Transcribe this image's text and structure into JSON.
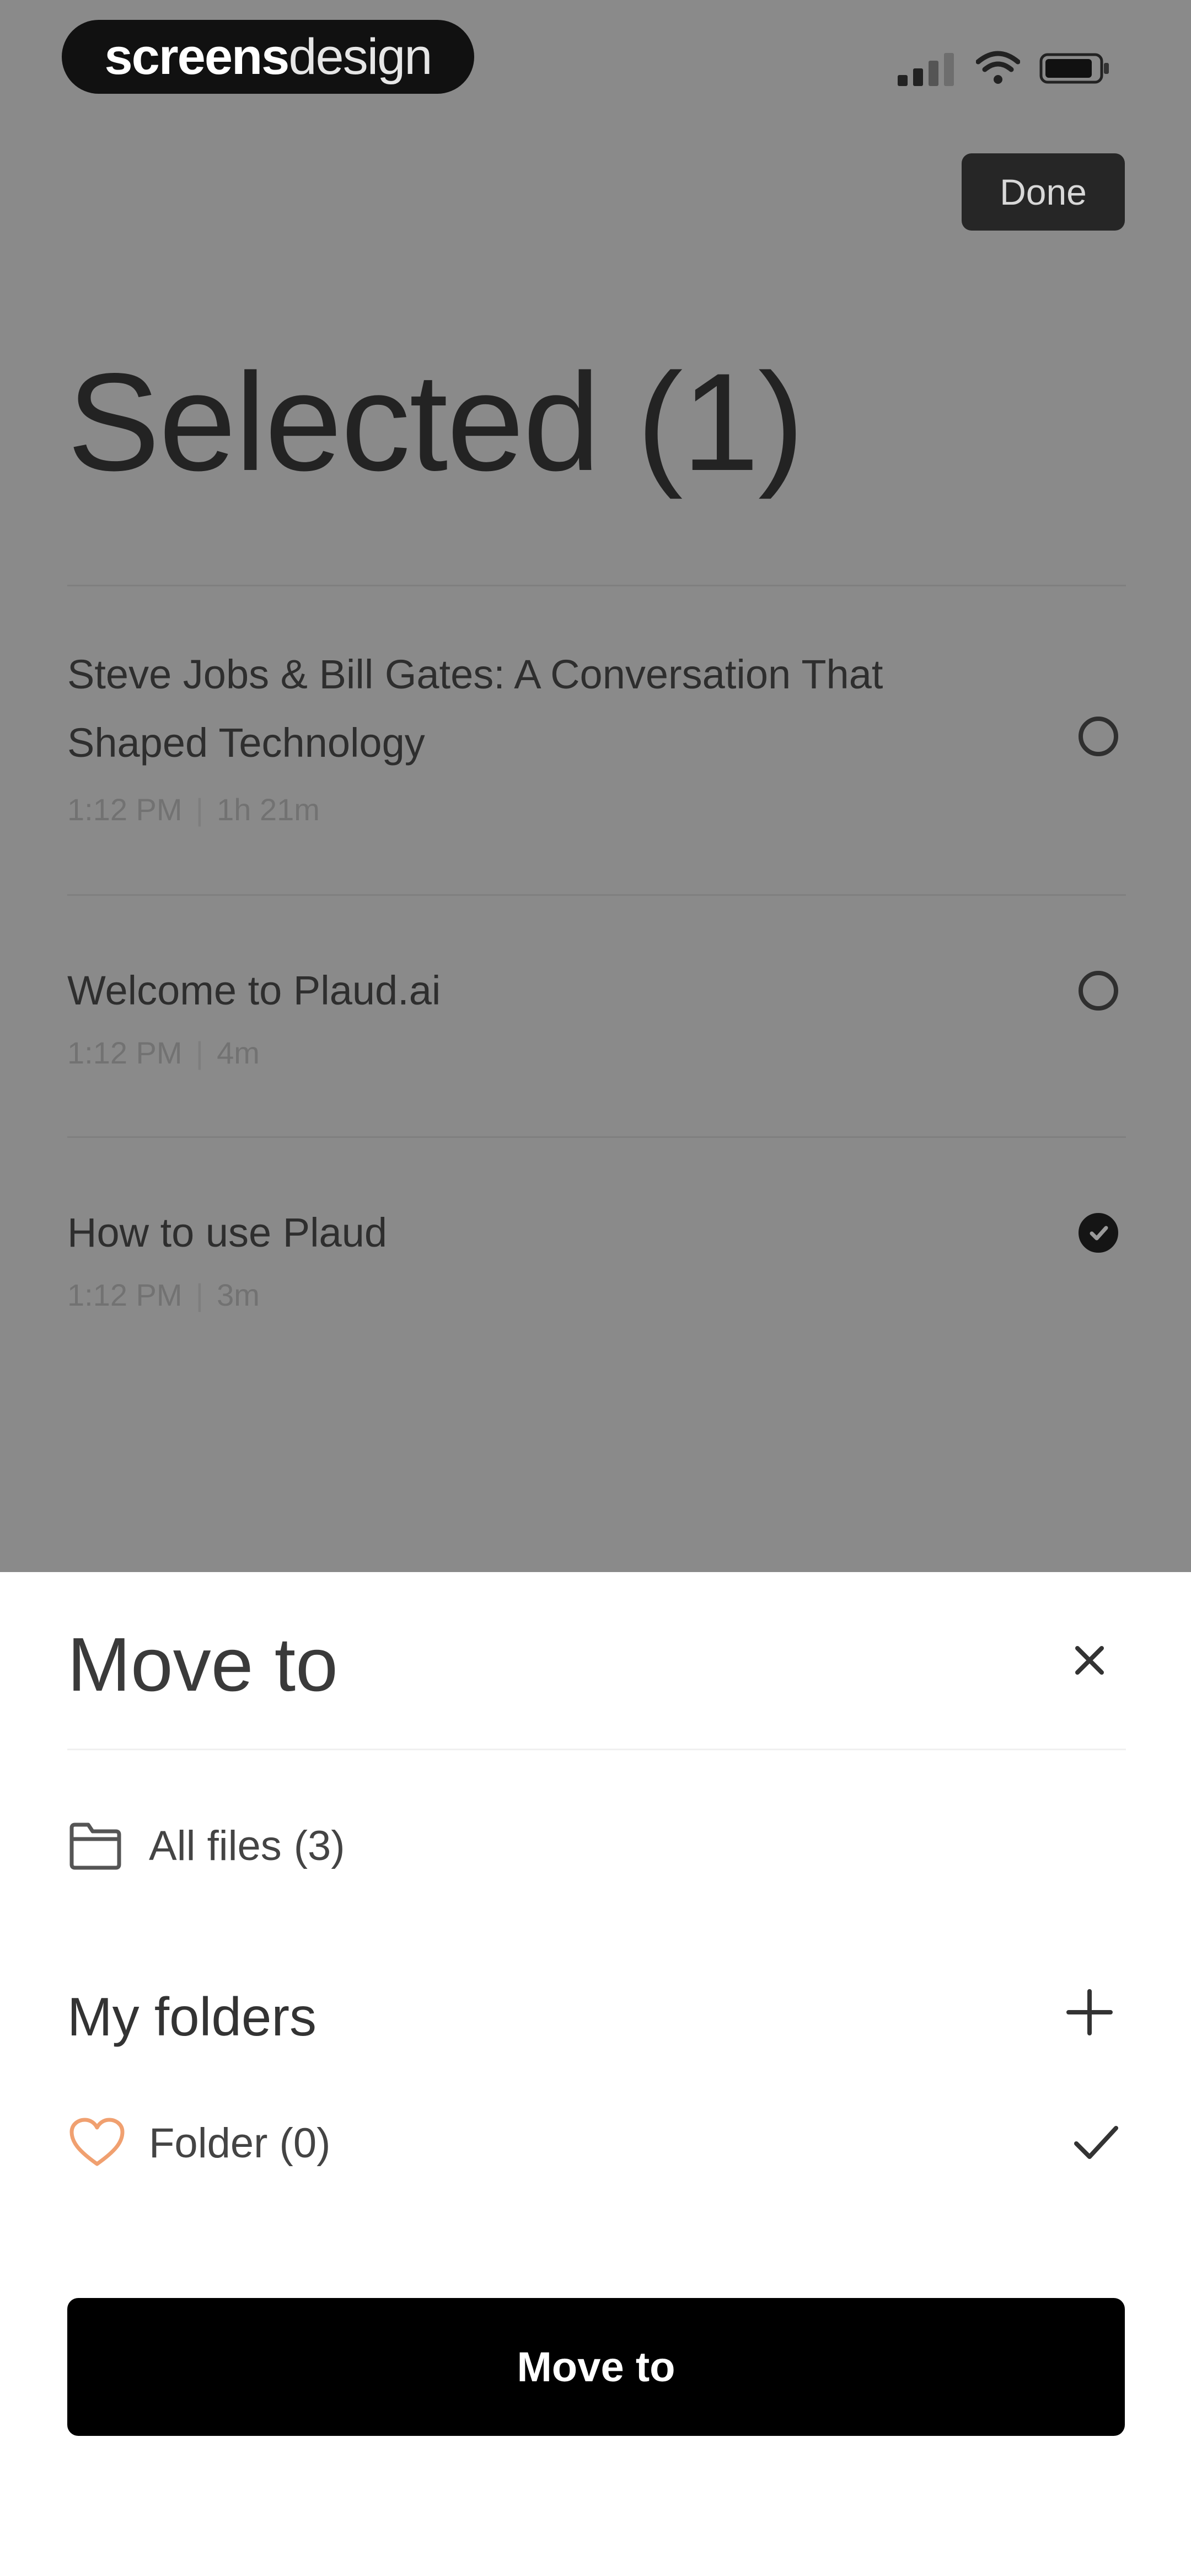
{
  "brand": {
    "logo_bold": "screens",
    "logo_light": "design"
  },
  "header": {
    "done_label": "Done",
    "title": "Selected (1)"
  },
  "recordings": [
    {
      "title": "Steve Jobs & Bill Gates: A Conversation That Shaped Technology",
      "time": "1:12 PM",
      "duration": "1h 21m",
      "selected": false
    },
    {
      "title": "Welcome to Plaud.ai",
      "time": "1:12 PM",
      "duration": "4m",
      "selected": false
    },
    {
      "title": "How to use Plaud",
      "time": "1:12 PM",
      "duration": "3m",
      "selected": true
    }
  ],
  "meta_separator": "|",
  "sheet": {
    "title": "Move to",
    "all_files": {
      "label": "All files",
      "count": "(3)"
    },
    "my_folders_title": "My folders",
    "folder": {
      "label": "Folder (0)",
      "icon": "heart-icon",
      "checked": true
    },
    "move_button_label": "Move to"
  },
  "colors": {
    "overlay": "#8a8a8a",
    "sheet_bg": "#ffffff",
    "primary_button": "#000000",
    "heart_accent": "#f0a070"
  }
}
